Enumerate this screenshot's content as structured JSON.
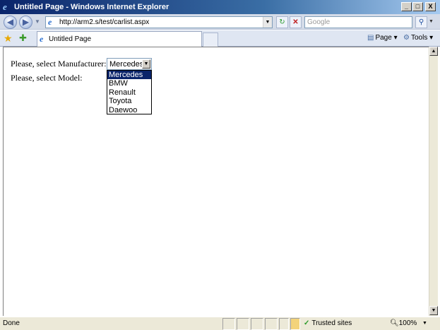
{
  "window": {
    "title": "Untitled Page - Windows Internet Explorer",
    "controls": [
      "_",
      "□",
      "X"
    ]
  },
  "addressbar": {
    "url": "http://arm2.s/test/carlist.aspx",
    "search_placeholder": "Google"
  },
  "tabs": [
    {
      "label": "Untitled Page"
    }
  ],
  "toolbar": {
    "page_label": "Page",
    "tools_label": "Tools"
  },
  "page": {
    "manufacturer_label": "Please, select Manufacturer:",
    "model_label": "Please, select Model:",
    "manufacturer_select": {
      "selected": "Mercedes",
      "options": [
        "Mercedes",
        "BMW",
        "Renault",
        "Toyota",
        "Daewoo"
      ]
    }
  },
  "statusbar": {
    "status": "Done",
    "zone": "Trusted sites",
    "zoom": "100%"
  }
}
